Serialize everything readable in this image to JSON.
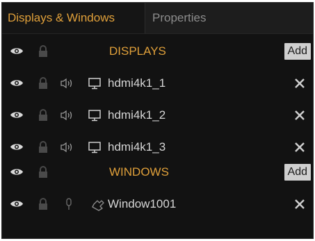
{
  "tabs": [
    {
      "label": "Displays & Windows",
      "active": true
    },
    {
      "label": "Properties",
      "active": false
    }
  ],
  "displays_section": {
    "title": "DISPLAYS",
    "add_label": "Add",
    "items": [
      {
        "name": "hdmi4k1_1"
      },
      {
        "name": "hdmi4k1_2"
      },
      {
        "name": "hdmi4k1_3"
      }
    ]
  },
  "windows_section": {
    "title": "WINDOWS",
    "add_label": "Add",
    "items": [
      {
        "name": "Window1001"
      }
    ]
  },
  "colors": {
    "accent": "#e0a03a",
    "panel_bg": "#121212",
    "tab_bar_bg": "#1d1d1d",
    "text": "#d6d6d6",
    "icon_bright": "#d8d8d8",
    "icon_dim": "#4a4a4a",
    "add_button_bg": "#cfcfcf"
  },
  "icons": {
    "visibility": "eye-icon",
    "lock": "lock-icon",
    "audio": "speaker-icon",
    "mic": "microphone-icon",
    "display": "monitor-icon",
    "window": "window-icon",
    "remove": "close-icon"
  }
}
